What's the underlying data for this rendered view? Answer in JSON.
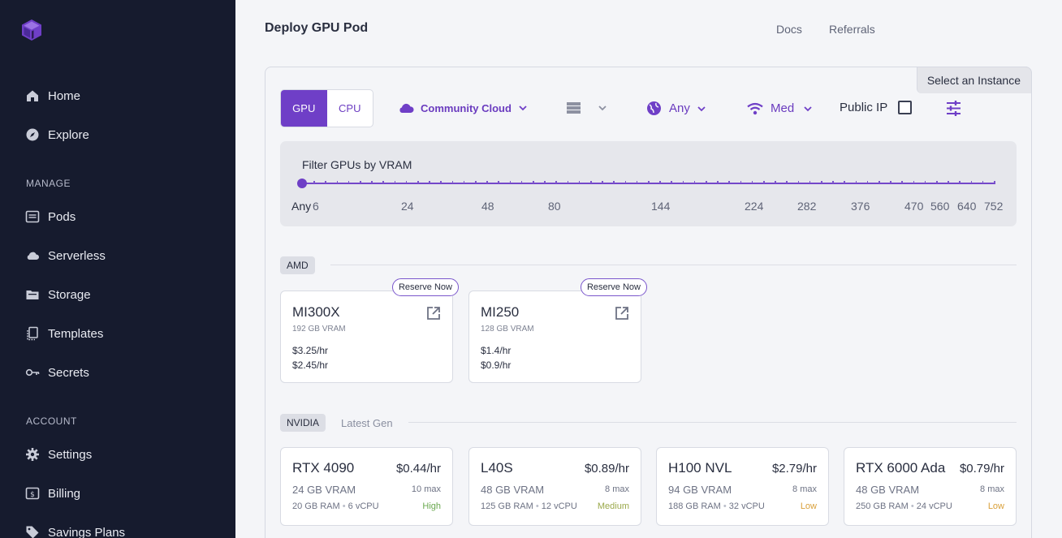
{
  "sidebar": {
    "items_top": [
      {
        "label": "Home",
        "icon": "home-icon"
      },
      {
        "label": "Explore",
        "icon": "compass-icon"
      }
    ],
    "manage_label": "MANAGE",
    "items_manage": [
      {
        "label": "Pods",
        "icon": "pods-icon"
      },
      {
        "label": "Serverless",
        "icon": "cloud-icon"
      },
      {
        "label": "Storage",
        "icon": "folder-icon"
      },
      {
        "label": "Templates",
        "icon": "templates-icon"
      },
      {
        "label": "Secrets",
        "icon": "key-icon"
      }
    ],
    "account_label": "ACCOUNT",
    "items_account": [
      {
        "label": "Settings",
        "icon": "gear-icon"
      },
      {
        "label": "Billing",
        "icon": "billing-icon"
      },
      {
        "label": "Savings Plans",
        "icon": "tag-icon"
      }
    ]
  },
  "header": {
    "title": "Deploy GPU Pod",
    "links": [
      "Docs",
      "Referrals"
    ]
  },
  "panel": {
    "select_instance": "Select an Instance",
    "toggle": {
      "gpu": "GPU",
      "cpu": "CPU",
      "active": "GPU"
    },
    "filters": {
      "cloud": "Community Cloud",
      "region": "Any",
      "network": "Med",
      "public_ip": "Public IP",
      "public_ip_checked": false
    },
    "vram": {
      "title": "Filter GPUs by VRAM",
      "any_label": "Any",
      "labels": [
        "6",
        "24",
        "48",
        "80",
        "144",
        "224",
        "282",
        "376",
        "470",
        "560",
        "640",
        "752"
      ],
      "selected": "Any"
    },
    "amd": {
      "tag": "AMD",
      "cards": [
        {
          "name": "MI300X",
          "vram": "192 GB VRAM",
          "price1": "$3.25/hr",
          "price2": "$2.45/hr",
          "reserve": "Reserve Now"
        },
        {
          "name": "MI250",
          "vram": "128 GB VRAM",
          "price1": "$1.4/hr",
          "price2": "$0.9/hr",
          "reserve": "Reserve Now"
        }
      ]
    },
    "nvidia": {
      "tag": "NVIDIA",
      "subtitle": "Latest Gen",
      "cards": [
        {
          "name": "RTX 4090",
          "price": "$0.44/hr",
          "vram": "24 GB VRAM",
          "max": "10 max",
          "ram": "20 GB RAM",
          "vcpu": "6 vCPU",
          "availability": "High"
        },
        {
          "name": "L40S",
          "price": "$0.89/hr",
          "vram": "48 GB VRAM",
          "max": "8 max",
          "ram": "125 GB RAM",
          "vcpu": "12 vCPU",
          "availability": "Medium"
        },
        {
          "name": "H100 NVL",
          "price": "$2.79/hr",
          "vram": "94 GB VRAM",
          "max": "8 max",
          "ram": "188 GB RAM",
          "vcpu": "32 vCPU",
          "availability": "Low"
        },
        {
          "name": "RTX 6000 Ada",
          "price": "$0.79/hr",
          "vram": "48 GB VRAM",
          "max": "8 max",
          "ram": "250 GB RAM",
          "vcpu": "24 vCPU",
          "availability": "Low"
        }
      ]
    }
  },
  "colors": {
    "accent": "#6f3fc7",
    "sidebar_bg": "#161b2e",
    "availability_high": "#6aa84f",
    "availability_medium": "#9aa84a",
    "availability_low": "#d9a03a"
  }
}
